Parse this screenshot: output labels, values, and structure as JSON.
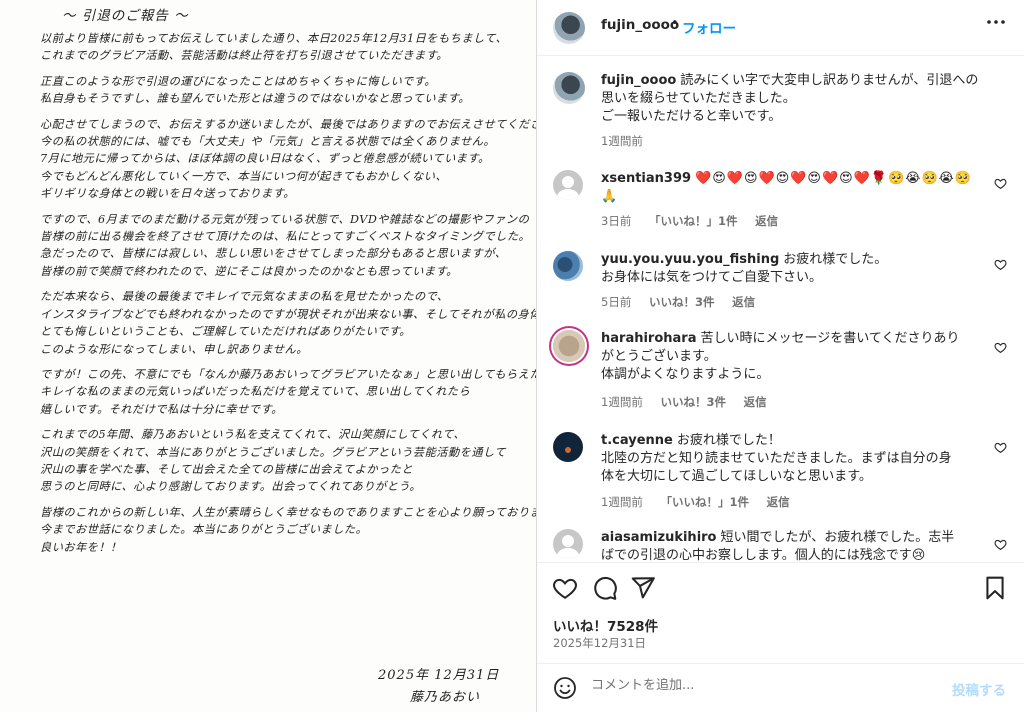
{
  "letter": {
    "title": "〜 引退のご報告 〜",
    "paragraphs": [
      [
        "以前より皆様に前もってお伝えしていました通り、本日2025年12月31日をもちまして、",
        "これまでのグラビア活動、芸能活動は終止符を打ち引退させていただきます。"
      ],
      [
        "正直このような形で引退の運びになったことはめちゃくちゃに悔しいです。",
        "私自身もそうですし、誰も望んでいた形とは違うのではないかなと思っています。"
      ],
      [
        "心配させてしまうので、お伝えするか迷いましたが、最後ではありますのでお伝えさせてください。",
        "今の私の状態的には、嘘でも「大丈夫」や「元気」と言える状態では全くありません。",
        "7月に地元に帰ってからは、ほぼ体調の良い日はなく、ずっと倦怠感が続いています。",
        "今でもどんどん悪化していく一方で、本当にいつ何が起きてもおかしくない、",
        "ギリギリな身体との戦いを日々送っております。"
      ],
      [
        "ですので、6月までのまだ動ける元気が残っている状態で、DVDや雑誌などの撮影やファンの",
        "皆様の前に出る機会を終了させて頂けたのは、私にとってすごくベストなタイミングでした。",
        "急だったので、皆様には寂しい、悲しい思いをさせてしまった部分もあると思いますが、",
        "皆様の前で笑顔で終われたので、逆にそこは良かったのかなとも思っています。"
      ],
      [
        "ただ本来なら、最後の最後までキレイで元気なままの私を見せたかったので、",
        "インスタライブなどでも終われなかったのですが現状それが出来ない事、そしてそれが私の身体",
        "とても悔しいということも、ご理解していただければありがたいです。",
        "このような形になってしまい、申し訳ありません。"
      ],
      [
        "ですが！この先、不意にでも「なんか藤乃あおいってグラビアいたなぁ」と思い出してもらえた時は、",
        "キレイな私のままの元気いっぱいだった私だけを覚えていて、思い出してくれたら",
        "嬉しいです。それだけで私は十分に幸せです。"
      ],
      [
        "これまでの5年間、藤乃あおいという私を支えてくれて、沢山笑顔にしてくれて、",
        "沢山の笑顔をくれて、本当にありがとうございました。グラビアという芸能活動を通して",
        "沢山の事を学べた事、そして出会えた全ての皆様に出会えてよかったと",
        "思うのと同時に、心より感謝しております。出会ってくれてありがとう。"
      ],
      [
        "皆様のこれからの新しい年、人生が素晴らしく幸せなものでありますことを心より願っております。",
        "今までお世話になりました。本当にありがとうございました。",
        "良いお年を！！"
      ]
    ],
    "date": "2025年 12月31日",
    "signature": "藤乃あおい"
  },
  "header": {
    "username": "fujin_oooo",
    "dot": "•",
    "follow_label": "フォロー",
    "more_label": "•••"
  },
  "caption": {
    "username": "fujin_oooo",
    "text": "読みにくい字で大変申し訳ありませんが、引退への思いを綴らせていただきました。",
    "text2": "ご一報いただけると幸いです。",
    "time": "1週間前"
  },
  "comments": [
    {
      "username": "xsentian399",
      "text": "❤️😍❤️😍❤️😍❤️😍❤️😍❤️🌹🥺😭🥺😭🥺🙏",
      "time": "3日前",
      "likes": "「いいね！」1件",
      "reply": "返信"
    },
    {
      "username": "yuu.you.yuu.you_fishing",
      "text": "お疲れ様でした。",
      "text2": "お身体には気をつけてご自愛下さい。",
      "time": "5日前",
      "likes": "いいね！3件",
      "reply": "返信"
    },
    {
      "username": "harahirohara",
      "text": "苦しい時にメッセージを書いてくださりありがとうございます。",
      "text2": "体調がよくなりますように。",
      "time": "1週間前",
      "likes": "いいね！3件",
      "reply": "返信"
    },
    {
      "username": "t.cayenne",
      "text": "お疲れ様でした！",
      "text2": "北陸の方だと知り読ませていただきました。まずは自分の身体を大切にして過ごしてほしいなと思います。",
      "time": "1週間前",
      "likes": "「いいね！」1件",
      "reply": "返信"
    },
    {
      "username": "aiasamizukihiro",
      "text": "短い間でしたが、お疲れ様でした。志半ばでの引退の心中お察しします。個人的には残念です😢"
    }
  ],
  "post": {
    "likes": "いいね！7528件",
    "date": "2025年12月31日",
    "comment_placeholder": "コメントを追加...",
    "post_label": "投稿する"
  }
}
